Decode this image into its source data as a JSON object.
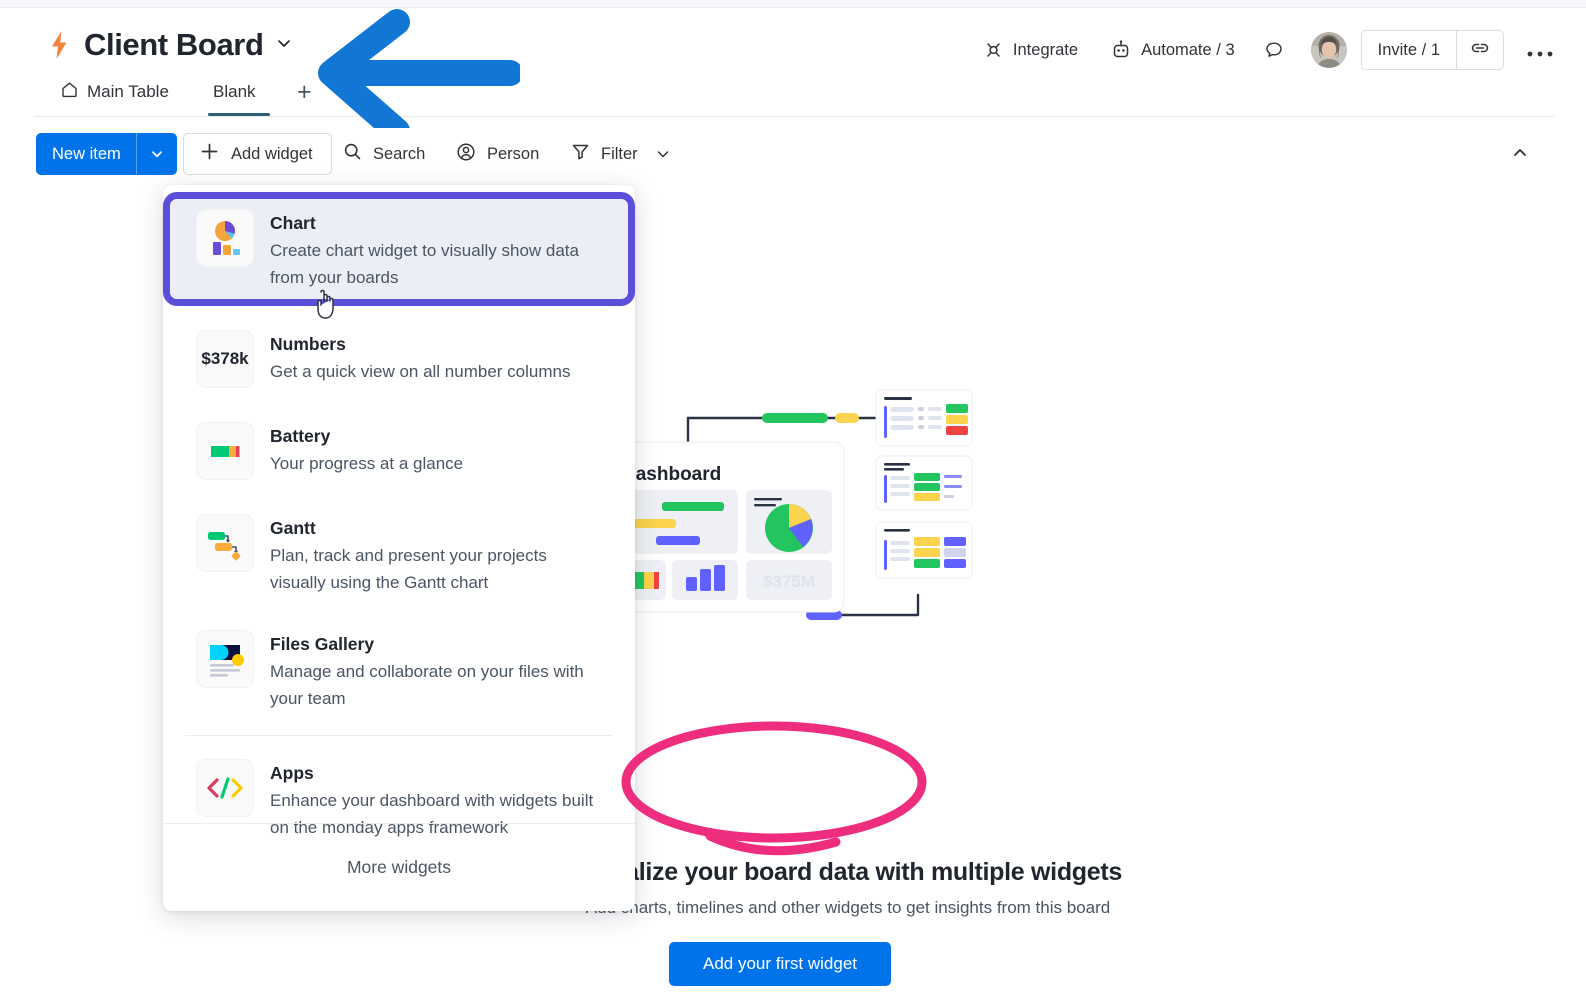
{
  "header": {
    "board_title": "Client Board",
    "logo_icon": "lightning-bolt-icon",
    "title_caret_icon": "chevron-down-icon",
    "integrate_label": "Integrate",
    "integrate_icon": "integrate-icon",
    "automate_label": "Automate / 3",
    "automate_icon": "robot-icon",
    "comment_icon": "speech-bubble-icon",
    "avatar_icon": "user-avatar",
    "invite_label": "Invite / 1",
    "invite_link_icon": "link-icon",
    "more_label": "•••",
    "more_icon": "kebab-menu-icon"
  },
  "tabs": {
    "items": [
      {
        "label": "Main Table",
        "icon": "home-icon",
        "active": false
      },
      {
        "label": "Blank",
        "icon": "",
        "active": true
      }
    ],
    "add_tab_label": "+"
  },
  "toolbar": {
    "new_item_label": "New item",
    "new_item_caret_icon": "chevron-down-icon",
    "add_widget_label": "Add widget",
    "add_widget_icon": "plus-icon",
    "search_label": "Search",
    "search_icon": "magnifier-icon",
    "person_label": "Person",
    "person_icon": "person-circle-icon",
    "filter_label": "Filter",
    "filter_icon": "funnel-icon",
    "filter_caret_icon": "chevron-down-icon",
    "collapse_icon": "chevron-up-icon"
  },
  "empty_state": {
    "title": "Visualize your board data with multiple widgets",
    "subtitle": "Add charts, timelines and other widgets to get insights from this board",
    "cta_label": "Add your first widget",
    "illustration_dashboard_label": "Dashboard",
    "illustration_number_value": "$375M"
  },
  "widget_menu": {
    "items": [
      {
        "title": "Chart",
        "description": "Create chart widget to visually show data from your boards",
        "icon": "chart-widget-icon",
        "highlighted": true
      },
      {
        "title": "Numbers",
        "description": "Get a quick view on all number columns",
        "icon": "numbers-widget-icon",
        "icon_text": "$378k",
        "highlighted": false
      },
      {
        "title": "Battery",
        "description": "Your progress at a glance",
        "icon": "battery-widget-icon",
        "highlighted": false
      },
      {
        "title": "Gantt",
        "description": "Plan, track and present your projects visually using the Gantt chart",
        "icon": "gantt-widget-icon",
        "highlighted": false
      },
      {
        "title": "Files Gallery",
        "description": "Manage and collaborate on your files with your team",
        "icon": "files-gallery-widget-icon",
        "highlighted": false
      },
      {
        "title": "Apps",
        "description": "Enhance your dashboard with widgets built on the monday apps framework",
        "icon": "apps-widget-icon",
        "highlighted": false
      }
    ],
    "footer_label": "More widgets"
  },
  "annotations": {
    "arrow_icon": "blue-left-arrow-annotation",
    "arrow_color": "#1277d4",
    "circle_icon": "pink-ellipse-annotation",
    "circle_color": "#ef2d7e",
    "highlight_box_icon": "purple-highlight-box-annotation",
    "highlight_color": "#5b4ed8"
  },
  "colors": {
    "primary_blue": "#0073ea",
    "tab_underline": "#2b5f72",
    "text_dark": "#20252e",
    "text_muted": "#4b5563",
    "bolt_orange": "#f5823c"
  }
}
